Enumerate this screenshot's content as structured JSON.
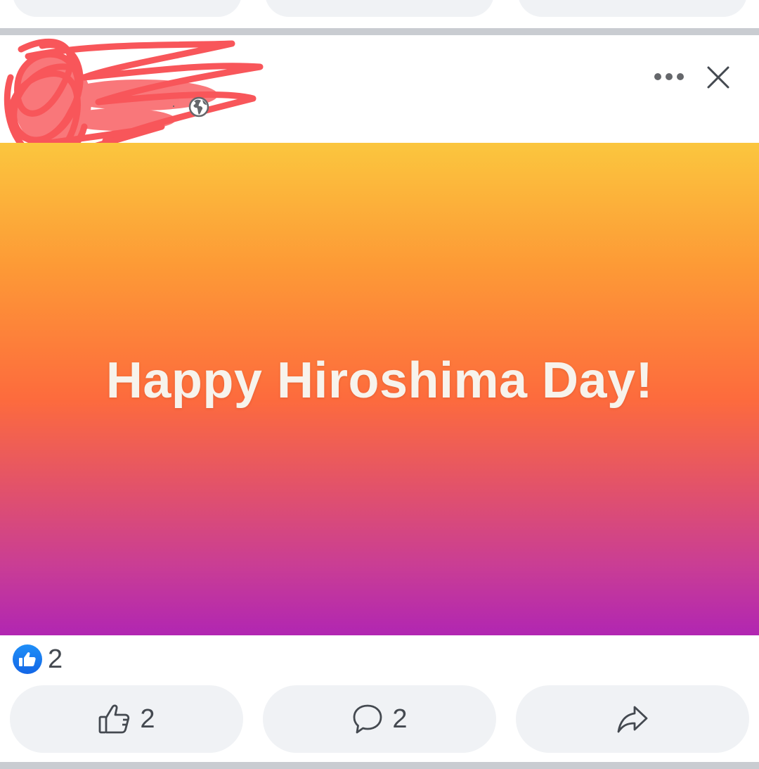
{
  "post": {
    "banner": {
      "text": "Happy Hiroshima Day!"
    },
    "reactions": {
      "icon": "like-badge-icon",
      "count": "2"
    },
    "actions": {
      "like": {
        "icon": "thumbs-up-outline-icon",
        "count": "2"
      },
      "comment": {
        "icon": "speech-bubble-icon",
        "count": "2"
      },
      "share": {
        "icon": "share-arrow-icon"
      }
    },
    "header": {
      "privacy_icon": "globe-icon",
      "more_icon": "more-horizontal-icon",
      "close_icon": "close-icon"
    }
  },
  "colors": {
    "accent": "#1877f2",
    "gradient": [
      "#fbc63e",
      "#fd9a36",
      "#fd6b3d",
      "#e2526a",
      "#c93d95",
      "#b126b2"
    ],
    "redaction": "#f8565a"
  }
}
